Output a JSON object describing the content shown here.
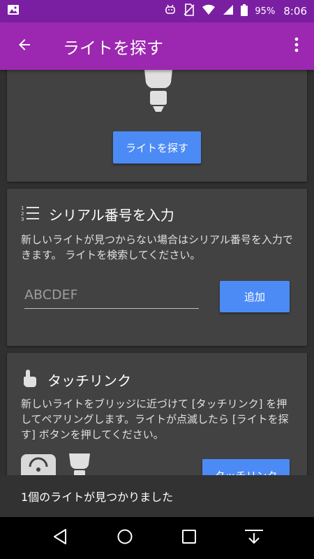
{
  "status_bar": {
    "battery": "95%",
    "time": "8:06",
    "left_icons": [
      "image-icon"
    ],
    "right_icons": [
      "android-icon",
      "no-sim-icon",
      "wifi-icon",
      "signal-icon",
      "battery-icon"
    ]
  },
  "app_bar": {
    "title": "ライトを探す",
    "background": "#9c27b0",
    "status_background": "#7b1fa2",
    "back_icon": "arrow-back-icon",
    "menu_icon": "more-vert-icon"
  },
  "find_card": {
    "button_label": "ライトを探す",
    "accent": "#4c8bf5"
  },
  "serial_card": {
    "icon": "numbered-list-icon",
    "title": "シリアル番号を入力",
    "description": "新しいライトが見つからない場合はシリアル番号を入力できます。 ライトを検索してください。",
    "input_placeholder": "ABCDEF",
    "input_value": "",
    "add_label": "追加"
  },
  "touchlink_card": {
    "icon": "touch-icon",
    "title": "タッチリンク",
    "description": "新しいライトをブリッジに近づけて [タッチリンク] を押してペアリングします。ライトが点滅したら [ライトを探す] ボタンを押してください。",
    "button_label": "タッチリンク"
  },
  "snackbar": {
    "message": "1個のライトが見つかりました"
  },
  "nav_bar": {
    "icons": [
      "back-triangle-icon",
      "home-circle-icon",
      "recents-square-icon",
      "download-icon"
    ]
  }
}
